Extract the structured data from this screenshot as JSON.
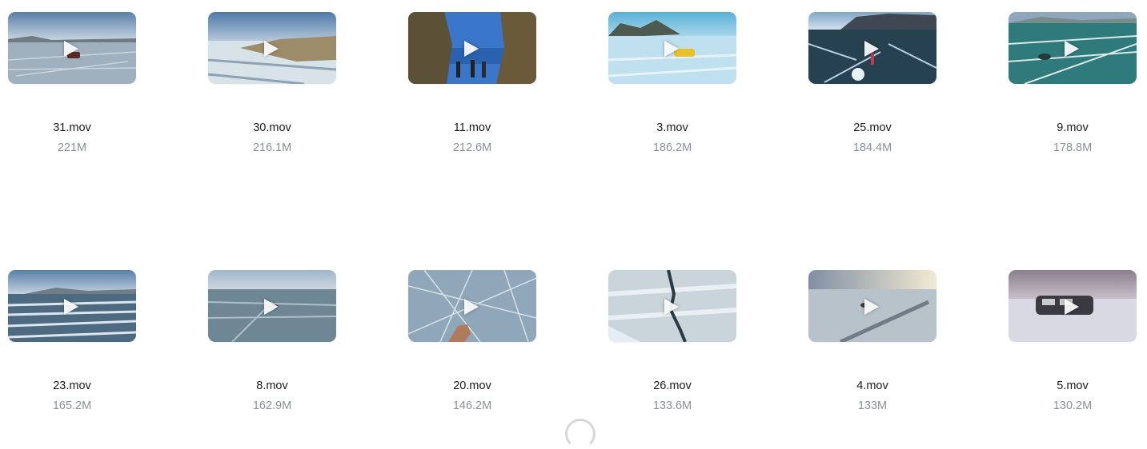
{
  "files": [
    {
      "name": "31.mov",
      "size": "221M",
      "scene": "ice-lake-hovercraft"
    },
    {
      "name": "30.mov",
      "size": "216.1M",
      "scene": "ice-shore-rocks"
    },
    {
      "name": "11.mov",
      "size": "212.6M",
      "scene": "cliff-gorge-people"
    },
    {
      "name": "3.mov",
      "size": "186.2M",
      "scene": "ice-cliffs-hovercraft"
    },
    {
      "name": "25.mov",
      "size": "184.4M",
      "scene": "dark-ice-cliff-sun"
    },
    {
      "name": "9.mov",
      "size": "178.8M",
      "scene": "turquoise-cracked-ice"
    },
    {
      "name": "23.mov",
      "size": "165.2M",
      "scene": "cracked-ice-plain"
    },
    {
      "name": "8.mov",
      "size": "162.9M",
      "scene": "grey-ice-plain"
    },
    {
      "name": "20.mov",
      "size": "146.2M",
      "scene": "ice-closeup-hand"
    },
    {
      "name": "26.mov",
      "size": "133.6M",
      "scene": "ice-crack-line"
    },
    {
      "name": "4.mov",
      "size": "133M",
      "scene": "sunset-ice-road"
    },
    {
      "name": "5.mov",
      "size": "130.2M",
      "scene": "hovercraft-on-snow"
    }
  ],
  "icons": {
    "play": "play-icon",
    "loading": "loading-spinner-icon"
  }
}
